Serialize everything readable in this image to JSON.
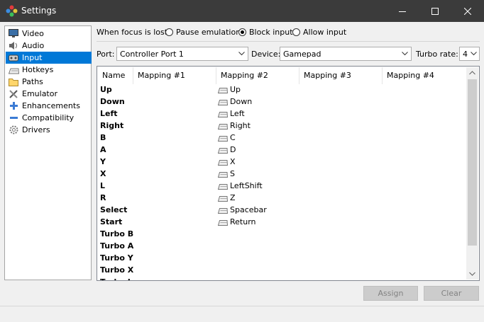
{
  "window": {
    "title": "Settings"
  },
  "sidebar": {
    "items": [
      {
        "label": "Video",
        "icon": "monitor-icon"
      },
      {
        "label": "Audio",
        "icon": "speaker-icon"
      },
      {
        "label": "Input",
        "icon": "gamepad-icon",
        "selected": true
      },
      {
        "label": "Hotkeys",
        "icon": "keyboard-icon"
      },
      {
        "label": "Paths",
        "icon": "folder-icon"
      },
      {
        "label": "Emulator",
        "icon": "tools-icon"
      },
      {
        "label": "Enhancements",
        "icon": "plus-icon"
      },
      {
        "label": "Compatibility",
        "icon": "minus-icon"
      },
      {
        "label": "Drivers",
        "icon": "gear-icon"
      }
    ]
  },
  "focus": {
    "label": "When focus is lost:",
    "options": [
      "Pause emulation",
      "Block input",
      "Allow input"
    ],
    "selected": "Block input"
  },
  "port": {
    "label": "Port:",
    "value": "Controller Port 1"
  },
  "device": {
    "label": "Device:",
    "value": "Gamepad"
  },
  "turbo": {
    "label": "Turbo rate:",
    "value": "4"
  },
  "table": {
    "headers": [
      "Name",
      "Mapping #1",
      "Mapping #2",
      "Mapping #3",
      "Mapping #4"
    ],
    "rows": [
      {
        "name": "Up",
        "mapping2": "Up"
      },
      {
        "name": "Down",
        "mapping2": "Down"
      },
      {
        "name": "Left",
        "mapping2": "Left"
      },
      {
        "name": "Right",
        "mapping2": "Right"
      },
      {
        "name": "B",
        "mapping2": "C"
      },
      {
        "name": "A",
        "mapping2": "D"
      },
      {
        "name": "Y",
        "mapping2": "X"
      },
      {
        "name": "X",
        "mapping2": "S"
      },
      {
        "name": "L",
        "mapping2": "LeftShift"
      },
      {
        "name": "R",
        "mapping2": "Z"
      },
      {
        "name": "Select",
        "mapping2": "Spacebar"
      },
      {
        "name": "Start",
        "mapping2": "Return"
      },
      {
        "name": "Turbo B",
        "mapping2": ""
      },
      {
        "name": "Turbo A",
        "mapping2": ""
      },
      {
        "name": "Turbo Y",
        "mapping2": ""
      },
      {
        "name": "Turbo X",
        "mapping2": ""
      },
      {
        "name": "Turbo L",
        "mapping2": ""
      }
    ]
  },
  "buttons": {
    "assign": "Assign",
    "clear": "Clear"
  },
  "colors": {
    "titlebar": "#3b3b3b",
    "selection": "#0078d7"
  }
}
